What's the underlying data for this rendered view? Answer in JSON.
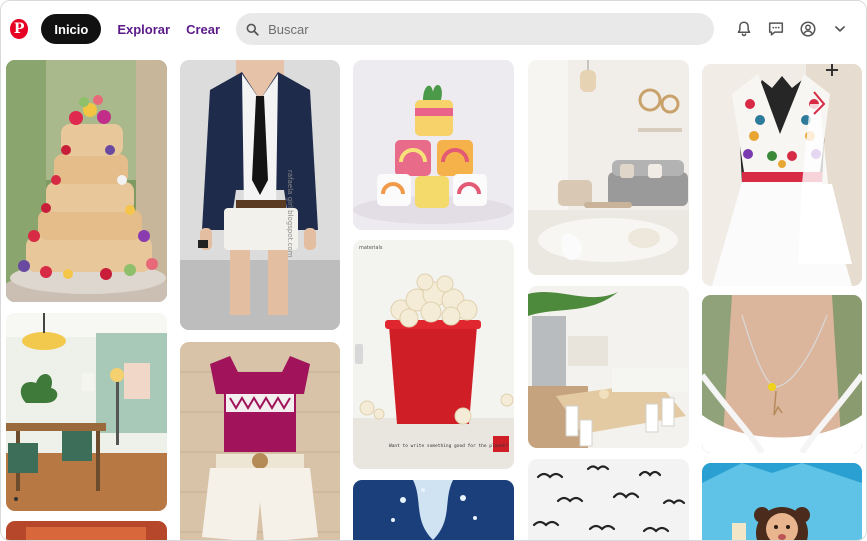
{
  "header": {
    "logo": "P",
    "nav": {
      "home": "Inicio",
      "explore": "Explorar",
      "create": "Crear"
    },
    "search": {
      "placeholder": "Buscar",
      "icon": "search-icon"
    },
    "icons": [
      "bell-icon",
      "chat-icon",
      "account-icon",
      "chevron-down-icon"
    ]
  },
  "pins": {
    "tshirt_note": "• • •",
    "watermark": "rafaela girl blogspot.com",
    "popcorn_caption": "Want to write something good for the planet?",
    "popcorn_top": "materials"
  },
  "colors": {
    "brand": "#e60023",
    "nav_text": "#5b1a8a",
    "search_bg": "#e9e9e9"
  }
}
